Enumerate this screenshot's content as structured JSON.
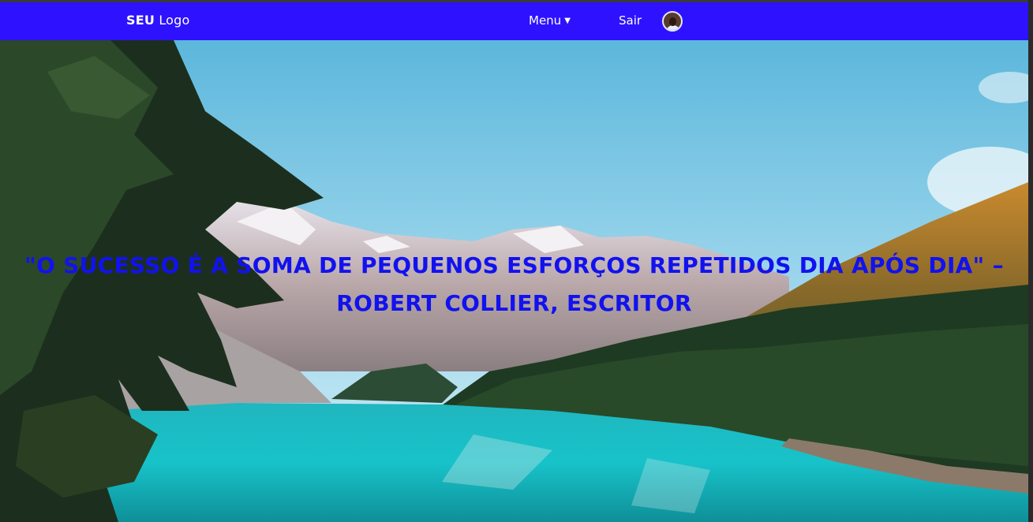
{
  "navbar": {
    "logo_bold": "SEU",
    "logo_text": "Logo",
    "menu_label": "Menu",
    "logout_label": "Sair",
    "background_color": "#2e12ff"
  },
  "hero": {
    "quote_line1": "\"O SUCESSO É A SOMA DE PEQUENOS ESFORÇOS REPETIDOS DIA APÓS DIA\" –",
    "quote_line2": "ROBERT COLLIER, ESCRITOR",
    "quote_color": "#1212ee",
    "background_description_icon": "mountain-lake-image"
  },
  "icons": {
    "menu_caret": "caret-down-icon",
    "avatar": "user-avatar"
  }
}
